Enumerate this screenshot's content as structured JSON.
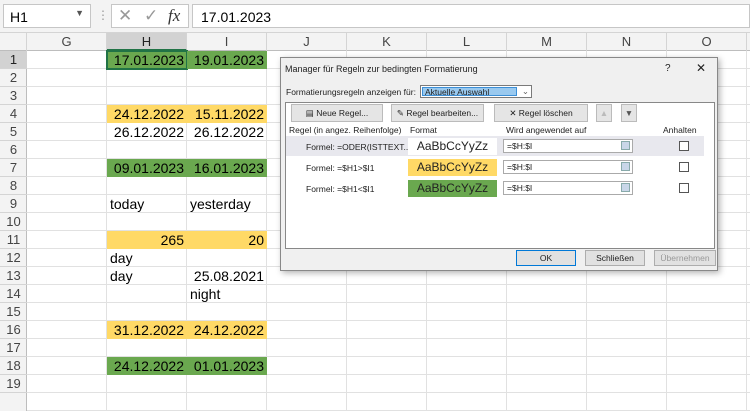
{
  "formula_bar": {
    "name_box": "H1",
    "formula": "17.01.2023",
    "cancel": "✕",
    "enter": "✓",
    "fx": "fx"
  },
  "columns": [
    "G",
    "H",
    "I",
    "J",
    "K",
    "L",
    "M",
    "N",
    "O"
  ],
  "rows": [
    "1",
    "2",
    "3",
    "4",
    "5",
    "6",
    "7",
    "8",
    "9",
    "10",
    "11",
    "12",
    "13",
    "14",
    "15",
    "16",
    "17",
    "18",
    "19"
  ],
  "cells": [
    {
      "row": 1,
      "col": "H",
      "value": "17.01.2023",
      "fill": "green",
      "align": "right"
    },
    {
      "row": 1,
      "col": "I",
      "value": "19.01.2023",
      "fill": "green",
      "align": "right"
    },
    {
      "row": 4,
      "col": "H",
      "value": "24.12.2022",
      "fill": "yellow",
      "align": "right"
    },
    {
      "row": 4,
      "col": "I",
      "value": "15.11.2022",
      "fill": "yellow",
      "align": "right"
    },
    {
      "row": 5,
      "col": "H",
      "value": "26.12.2022",
      "fill": "",
      "align": "right"
    },
    {
      "row": 5,
      "col": "I",
      "value": "26.12.2022",
      "fill": "",
      "align": "right"
    },
    {
      "row": 7,
      "col": "H",
      "value": "09.01.2023",
      "fill": "green",
      "align": "right"
    },
    {
      "row": 7,
      "col": "I",
      "value": "16.01.2023",
      "fill": "green",
      "align": "right"
    },
    {
      "row": 9,
      "col": "H",
      "value": "today",
      "fill": "",
      "align": "left"
    },
    {
      "row": 9,
      "col": "I",
      "value": "yesterday",
      "fill": "",
      "align": "left"
    },
    {
      "row": 11,
      "col": "H",
      "value": "265",
      "fill": "yellow",
      "align": "right"
    },
    {
      "row": 11,
      "col": "I",
      "value": "20",
      "fill": "yellow",
      "align": "right"
    },
    {
      "row": 12,
      "col": "H",
      "value": "day",
      "fill": "",
      "align": "left"
    },
    {
      "row": 13,
      "col": "H",
      "value": "day",
      "fill": "",
      "align": "left"
    },
    {
      "row": 13,
      "col": "I",
      "value": "25.08.2021",
      "fill": "",
      "align": "right"
    },
    {
      "row": 14,
      "col": "I",
      "value": "night",
      "fill": "",
      "align": "left"
    },
    {
      "row": 16,
      "col": "H",
      "value": "31.12.2022",
      "fill": "yellow",
      "align": "right"
    },
    {
      "row": 16,
      "col": "I",
      "value": "24.12.2022",
      "fill": "yellow",
      "align": "right"
    },
    {
      "row": 18,
      "col": "H",
      "value": "24.12.2022",
      "fill": "green",
      "align": "right"
    },
    {
      "row": 18,
      "col": "I",
      "value": "01.01.2023",
      "fill": "green",
      "align": "right"
    }
  ],
  "dialog": {
    "title": "Manager für Regeln zur bedingten Formatierung",
    "help": "?",
    "close": "✕",
    "show_label": "Formatierungsregeln anzeigen für:",
    "show_value": "Aktuelle Auswahl",
    "new_rule": "Neue Regel...",
    "edit_rule": "Regel bearbeiten...",
    "delete_rule": "Regel löschen",
    "headers": {
      "rule": "Regel (in angez. Reihenfolge)",
      "format": "Format",
      "applies": "Wird angewendet auf",
      "stop": "Anhalten"
    },
    "rules": [
      {
        "formula": "Formel: =ODER(ISTTEXT...",
        "preview": "AaBbCcYyZz",
        "applies": "=$H:$I",
        "fill": "#ffffff"
      },
      {
        "formula": "Formel: =$H1>$I1",
        "preview": "AaBbCcYyZz",
        "applies": "=$H:$I",
        "fill": "#ffd966"
      },
      {
        "formula": "Formel: =$H1<$I1",
        "preview": "AaBbCcYyZz",
        "applies": "=$H:$I",
        "fill": "#6aa84f"
      }
    ],
    "ok": "OK",
    "close_btn": "Schließen",
    "apply": "Übernehmen"
  }
}
